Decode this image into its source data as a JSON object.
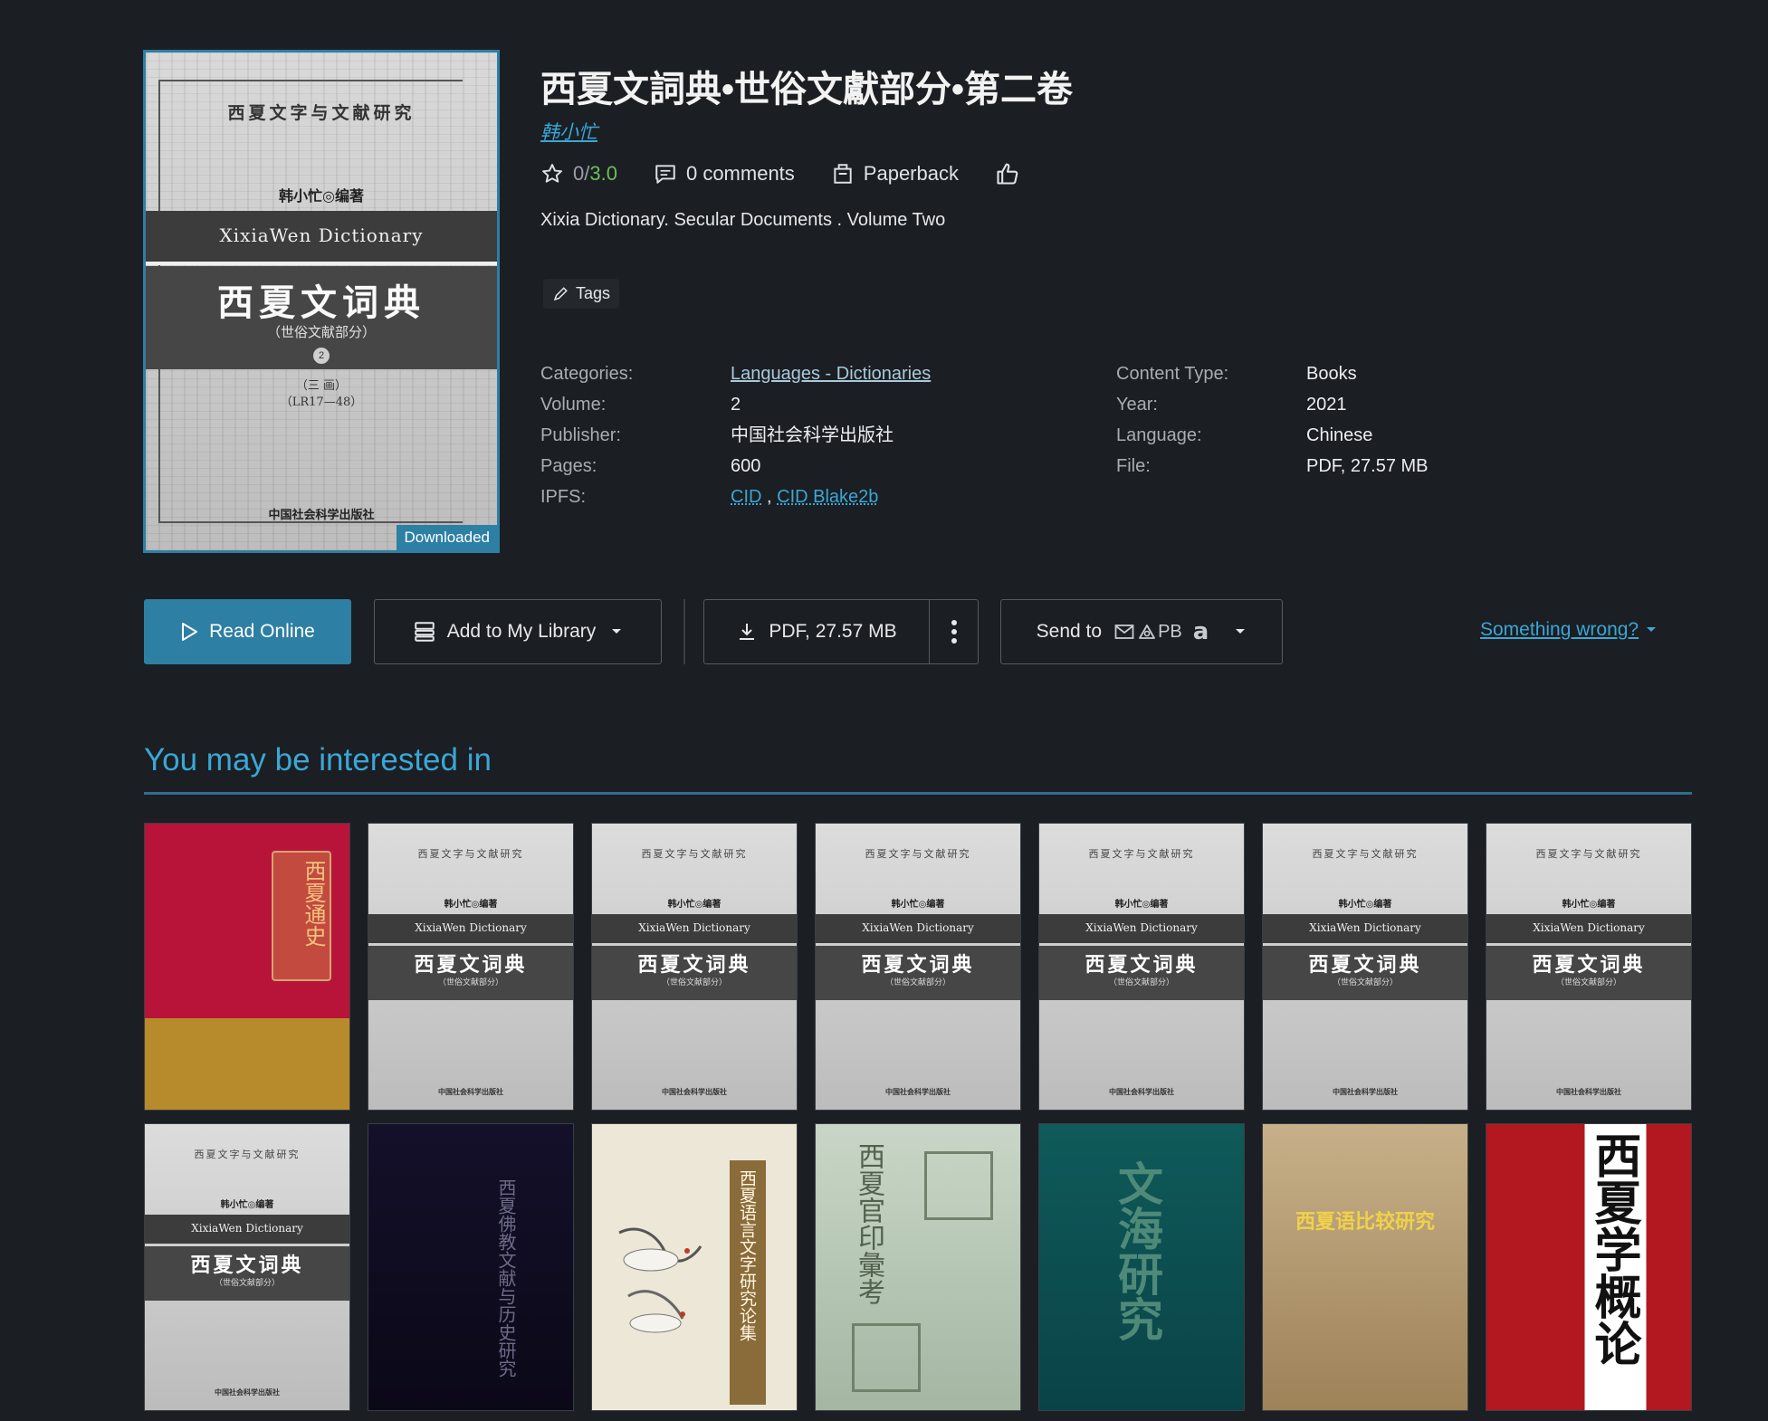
{
  "book": {
    "title": "西夏文詞典•世俗文獻部分•第二卷",
    "author": "韩小忙",
    "rating": "0",
    "rating_sep": " / ",
    "rating_quality": "3.0",
    "comments": "0 comments",
    "format": "Paperback",
    "description": "Xixia Dictionary. Secular Documents . Volume Two",
    "tags_label": "Tags",
    "cover": {
      "series": "西夏文字与文献研究",
      "author": "韩小忙◎编著",
      "english": "XixiaWen Dictionary",
      "chinese": "西夏文词典",
      "subtitle": "（世俗文献部分）",
      "number": "2",
      "volume_line1": "（三 画）",
      "volume_line2": "（LR17—48）",
      "publisher": "中国社会科学出版社",
      "badge": "Downloaded"
    }
  },
  "details_left": [
    {
      "label": "Categories:",
      "value": "Languages - Dictionaries"
    },
    {
      "label": "Volume:",
      "value": "2"
    },
    {
      "label": "Publisher:",
      "value": "中国社会科学出版社"
    },
    {
      "label": "Pages:",
      "value": "600"
    },
    {
      "label": "IPFS:",
      "value1": "CID",
      "sep": " , ",
      "value2": "CID Blake2b"
    }
  ],
  "details_right": [
    {
      "label": "Content Type:",
      "value": "Books"
    },
    {
      "label": "Year:",
      "value": "2021"
    },
    {
      "label": "Language:",
      "value": "Chinese"
    },
    {
      "label": "File:",
      "value": "PDF, 27.57 MB"
    }
  ],
  "actions": {
    "read_online": "Read Online",
    "add_library": "Add to My Library",
    "download": "PDF, 27.57 MB",
    "send_to": "Send to",
    "send_pb": "PB",
    "send_amazon": "a",
    "something_wrong": "Something wrong?"
  },
  "recommendations": {
    "heading": "You may be interested in",
    "books": [
      {
        "style": "red",
        "text": "西夏通史"
      },
      {
        "style": "gray"
      },
      {
        "style": "gray"
      },
      {
        "style": "gray"
      },
      {
        "style": "gray"
      },
      {
        "style": "gray"
      },
      {
        "style": "gray"
      },
      {
        "style": "gray"
      },
      {
        "style": "dark",
        "text": "西夏佛教文献与历史研究"
      },
      {
        "style": "cranes",
        "text": "西夏语言文字研究论集"
      },
      {
        "style": "seal",
        "text": "西夏官印彙考"
      },
      {
        "style": "teal",
        "text": "文海研究"
      },
      {
        "style": "tan",
        "text": "西夏语比较研究"
      },
      {
        "style": "crimson",
        "text": "西夏学概论"
      }
    ]
  },
  "colors": {
    "background": "#1b1e22",
    "accent": "#2d7fa4",
    "link": "#3aa7d6",
    "rating_green": "#6bbf5a"
  },
  "icons": [
    "star-icon",
    "comment-icon",
    "paperback-icon",
    "thumbs-up-icon",
    "pencil-icon",
    "play-icon",
    "library-icon",
    "caret-down-icon",
    "download-icon",
    "kebab-icon",
    "mail-icon",
    "pocketbook-icon"
  ]
}
